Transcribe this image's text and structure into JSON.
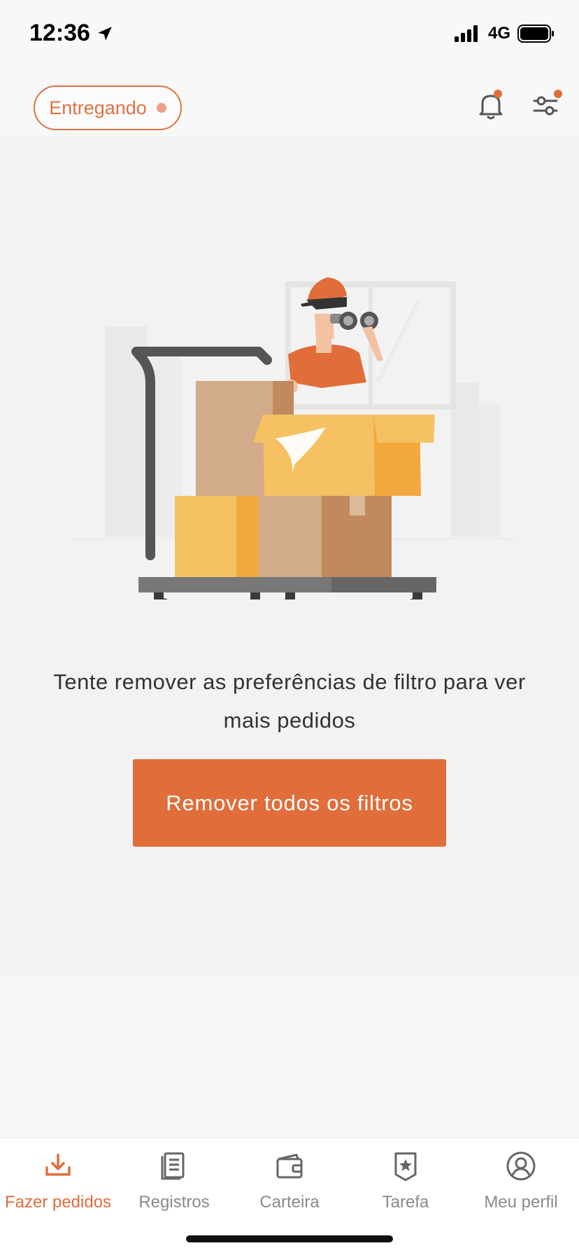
{
  "status_bar": {
    "time": "12:36",
    "network": "4G"
  },
  "header": {
    "status_label": "Entregando",
    "accent_color": "#e07240",
    "notification_dot": true
  },
  "main": {
    "message": "Tente remover as preferências de filtro para ver mais pedidos",
    "button_label": "Remover todos os filtros"
  },
  "nav": {
    "items": [
      {
        "label": "Fazer pedidos",
        "icon": "download-icon",
        "active": true
      },
      {
        "label": "Registros",
        "icon": "document-list-icon",
        "active": false
      },
      {
        "label": "Carteira",
        "icon": "wallet-icon",
        "active": false
      },
      {
        "label": "Tarefa",
        "icon": "star-badge-icon",
        "active": false
      },
      {
        "label": "Meu perfil",
        "icon": "profile-icon",
        "active": false
      }
    ]
  }
}
